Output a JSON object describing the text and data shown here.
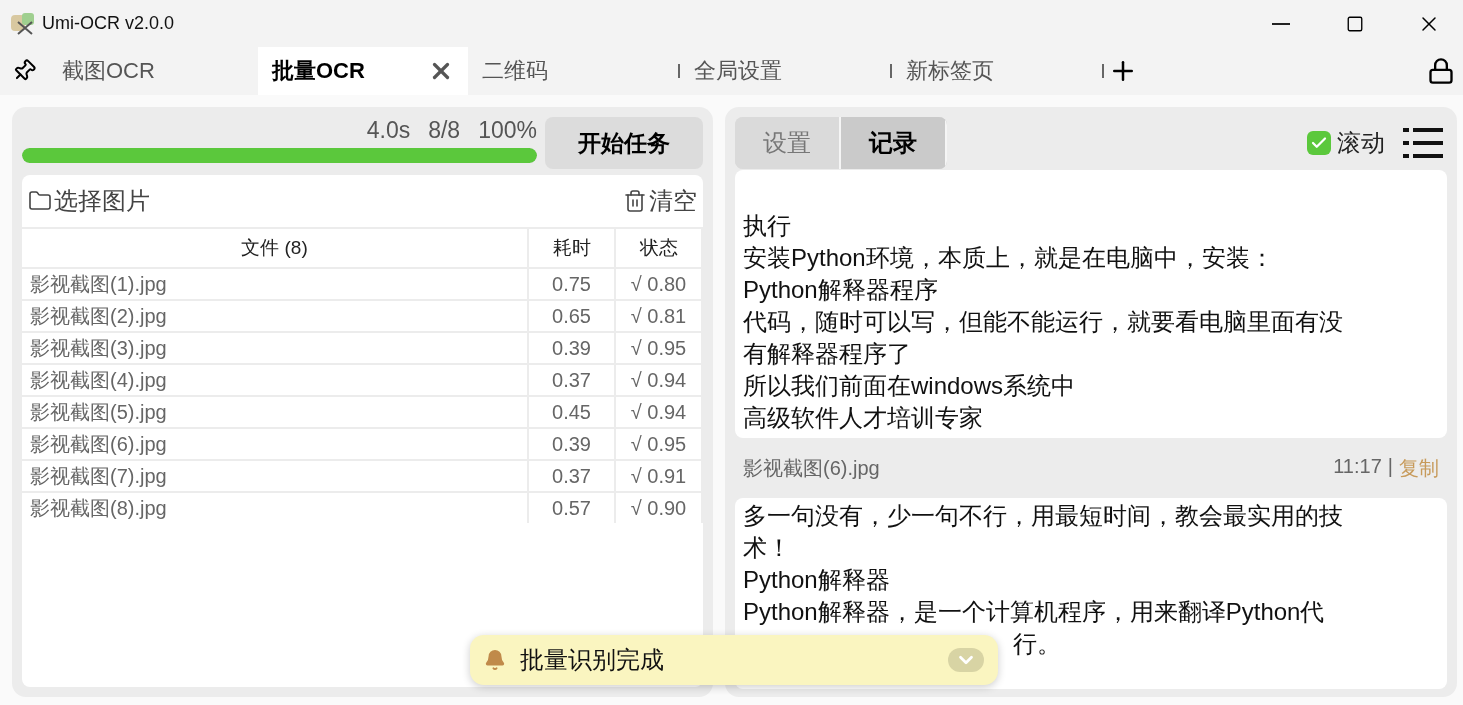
{
  "window": {
    "title": "Umi-OCR v2.0.0"
  },
  "tabs": [
    {
      "label": "截图OCR",
      "selected": false
    },
    {
      "label": "批量OCR",
      "selected": true
    },
    {
      "label": "二维码",
      "selected": false
    },
    {
      "label": "全局设置",
      "selected": false
    },
    {
      "label": "新标签页",
      "selected": false
    }
  ],
  "task": {
    "time": "4.0s",
    "count": "8/8",
    "percent": "100%",
    "level": 1,
    "start_button": "开始任务"
  },
  "file_toolbar": {
    "select": "选择图片",
    "clear": "清空"
  },
  "table": {
    "columns": [
      "文件 (8)",
      "耗时",
      "状态"
    ],
    "rows": [
      [
        "影视截图(1).jpg",
        "0.75",
        "√ 0.80"
      ],
      [
        "影视截图(2).jpg",
        "0.65",
        "√ 0.81"
      ],
      [
        "影视截图(3).jpg",
        "0.39",
        "√ 0.95"
      ],
      [
        "影视截图(4).jpg",
        "0.37",
        "√ 0.94"
      ],
      [
        "影视截图(5).jpg",
        "0.45",
        "√ 0.94"
      ],
      [
        "影视截图(6).jpg",
        "0.39",
        "√ 0.95"
      ],
      [
        "影视截图(7).jpg",
        "0.37",
        "√ 0.91"
      ],
      [
        "影视截图(8).jpg",
        "0.57",
        "√ 0.90"
      ]
    ]
  },
  "panel_tabs": [
    {
      "label": "设置",
      "selected": false
    },
    {
      "label": "记录",
      "selected": true
    }
  ],
  "scroll_toggle": {
    "label": "滚动",
    "checked": true
  },
  "records": [
    {
      "lines": [
        {
          "kind": "line",
          "text": "执行"
        },
        {
          "kind": "line",
          "text": "安装Python环境，本质上，就是在电脑中，安装："
        },
        {
          "kind": "line",
          "text": "Python解释器程序"
        },
        {
          "kind": "line",
          "text": "代码，随时可以写，但能不能运行，就要看电脑里面有没"
        },
        {
          "kind": "line",
          "text": "有解释器程序了"
        },
        {
          "kind": "line",
          "text": "所以我们前面在windows系统中"
        },
        {
          "kind": "line",
          "text": "高级软件人才培训专家"
        }
      ]
    },
    {
      "file": "影视截图(6).jpg",
      "time": "11:17",
      "separator": "|",
      "copy": "复制",
      "lines": [
        {
          "kind": "line",
          "text": "多一句没有，少一句不行，用最短时间，教会最实用的技"
        },
        {
          "kind": "line",
          "text": "术！"
        },
        {
          "kind": "line",
          "text": "Python解释器"
        },
        {
          "kind": "line",
          "text": "Python解释器，是一个计算机程序，用来翻译Python代"
        },
        {
          "kind": "tail",
          "text": "行。"
        }
      ]
    }
  ],
  "toast": {
    "message": "批量识别完成"
  }
}
